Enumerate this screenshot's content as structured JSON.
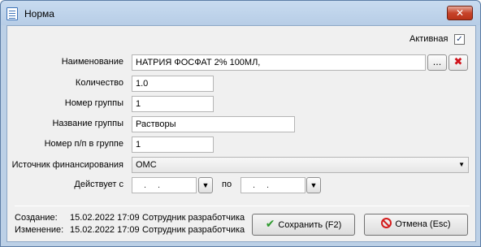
{
  "window": {
    "title": "Норма",
    "close": "✕"
  },
  "form": {
    "active_label": "Активная",
    "active_checked": true,
    "name_label": "Наименование",
    "name_value": "НАТРИЯ ФОСФАТ 2% 100МЛ,",
    "browse_label": "...",
    "clear_symbol": "✖",
    "qty_label": "Количество",
    "qty_value": "1.0",
    "group_no_label": "Номер группы",
    "group_no_value": "1",
    "group_name_label": "Название группы",
    "group_name_value": "Растворы",
    "pos_label": "Номер п/п в группе",
    "pos_value": "1",
    "source_label": "Источник финансирования",
    "source_value": "ОМС",
    "valid_from_label": "Действует с",
    "valid_from_value": "..",
    "valid_to_label": "по",
    "valid_to_value": ".."
  },
  "footer": {
    "created_label": "Создание:",
    "created_time": "15.02.2022 17:09",
    "created_user": "Сотрудник разработчика",
    "modified_label": "Изменение:",
    "modified_time": "15.02.2022 17:09",
    "modified_user": "Сотрудник разработчика",
    "save_label": "Сохранить (F2)",
    "cancel_label": "Отмена (Esc)"
  }
}
